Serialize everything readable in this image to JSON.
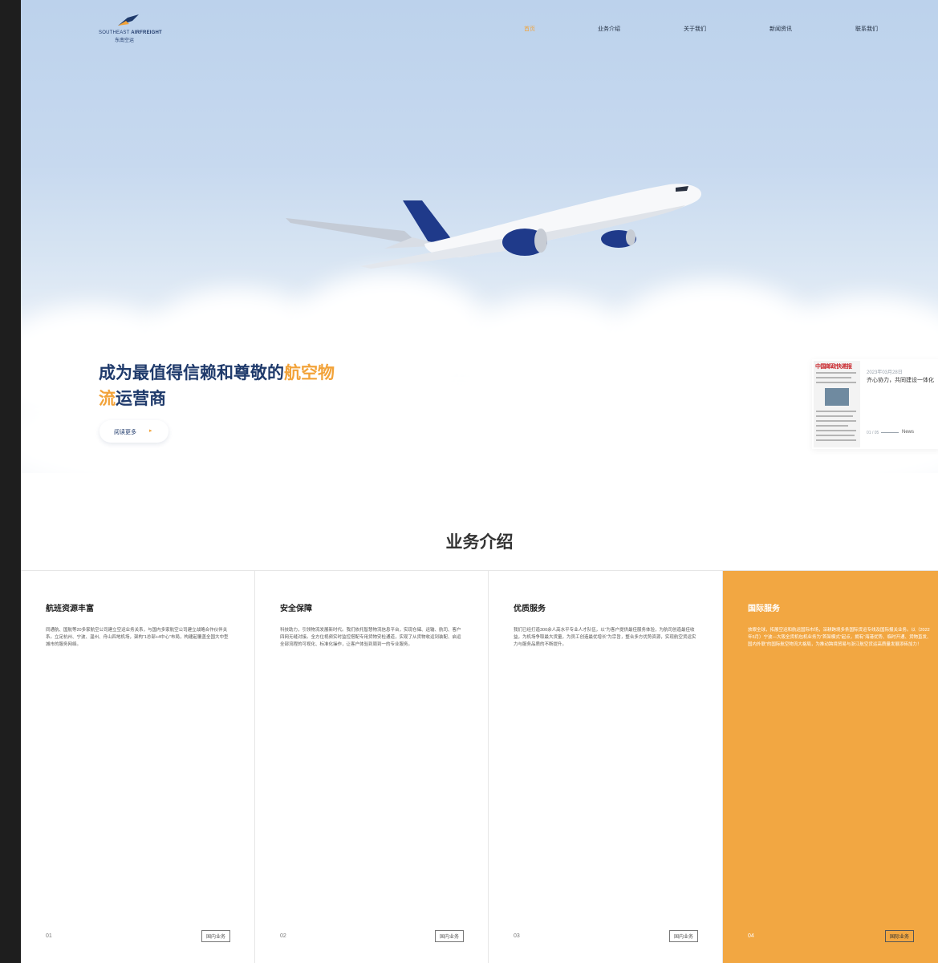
{
  "brand": {
    "name_en_prefix": "SOUTHEAST ",
    "name_en_bold": "AIRFREIGHT",
    "name_cn": "东南空运"
  },
  "nav": {
    "items": [
      {
        "label": "首页",
        "active": true
      },
      {
        "label": "业务介绍",
        "active": false
      },
      {
        "label": "关于我们",
        "active": false
      },
      {
        "label": "新闻资讯",
        "active": false
      },
      {
        "label": "联系我们",
        "active": false
      }
    ]
  },
  "hero": {
    "slogan_line1": "成为最值得信赖和尊敬的",
    "slogan_highlight1": "航空物",
    "slogan_highlight2": "流",
    "slogan_line2": "运营商",
    "more_button": "阅读更多",
    "more_arrow": "▸"
  },
  "news": {
    "thumb_title": "中国邮政快递报",
    "date": "2023年03月28日",
    "title": "齐心协力，共同建设一体化",
    "index": "01 / 05",
    "label": "News"
  },
  "business": {
    "title": "业务介绍",
    "cards": [
      {
        "title": "航班资源丰富",
        "desc": "同通航、国航等20多家航空公司建立空运业务关系，与国内多家航空公司建立战略合作伙伴关系。立足杭州、宁波、温州、舟山四地机场，架构“1总部+4中心”布局，构建起覆盖全国大中型城市的服务网络。",
        "num": "01",
        "tag": "国内业务"
      },
      {
        "title": "安全保障",
        "desc": "科技助力，引领物流发展新时代。我们依托智慧物流信息平台，实现仓储、运输、航司、客户四网无缝对接。全方位视频实时监控搭配专用货物安检通道，实现了从货物收运到装配、启运全部流程的可视化、标准化操作，让客户体验到周到一的专业服务。",
        "num": "02",
        "tag": "国内业务"
      },
      {
        "title": "优质服务",
        "desc": "我们已经打造300余人高水平专业人才队伍，以“为客户提供最佳服务体验，为航司创造最佳收益，为机场争取最大货量，为员工创造最优增长”为宗旨，整合多方优势资源，实现航空货运实力与服务品质的不断提升。",
        "num": "03",
        "tag": "国内业务"
      },
      {
        "title": "国际服务",
        "desc": "放眼全球，拓展空运和航运国际市场，深耕跨境多条国际货运专线及国际报关业务。以（2022年5月）宁波—大阪全货机包机业务为“首架模式”起点，拥有“海港优势、临时开通、货物直发、国内外联”的国际航空物流大格局，为推动跨境贸易与浙江航空货运高质量发展添砖加力！",
        "num": "04",
        "tag": "国际业务"
      }
    ]
  },
  "colors": {
    "accent": "#f2a33a",
    "navy": "#1f3a6b",
    "card_highlight": "#f2a742"
  }
}
